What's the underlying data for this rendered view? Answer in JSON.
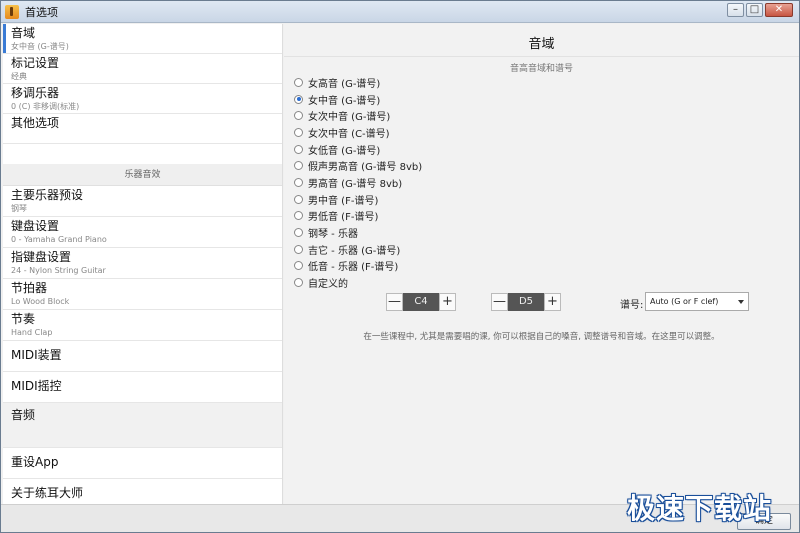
{
  "window": {
    "title": "首选项"
  },
  "sidebar": {
    "items": [
      {
        "label": "音域",
        "sub": "女中音 (G-谱号)"
      },
      {
        "label": "标记设置",
        "sub": "经典"
      },
      {
        "label": "移调乐器",
        "sub": "0 (C) 非移调(标准)"
      },
      {
        "label": "其他选项",
        "sub": ""
      }
    ],
    "section_title": "乐器音效",
    "instrument_items": [
      {
        "label": "主要乐器预设",
        "sub": "钢琴"
      },
      {
        "label": "键盘设置",
        "sub": "0 - Yamaha Grand Piano"
      },
      {
        "label": "指键盘设置",
        "sub": "24 - Nylon String Guitar"
      },
      {
        "label": "节拍器",
        "sub": "Lo Wood Block"
      },
      {
        "label": "节奏",
        "sub": "Hand Clap"
      },
      {
        "label": "MIDI装置",
        "sub": ""
      },
      {
        "label": "MIDI摇控",
        "sub": ""
      }
    ],
    "audio_label": "音频",
    "reset_label": "重设App",
    "about_label": "关于练耳大师"
  },
  "main": {
    "title": "音域",
    "subtitle": "音高音域和谱号",
    "options": [
      {
        "label": "女高音 (G-谱号)",
        "checked": false
      },
      {
        "label": "女中音 (G-谱号)",
        "checked": true
      },
      {
        "label": "女次中音 (G-谱号)",
        "checked": false
      },
      {
        "label": "女次中音 (C-谱号)",
        "checked": false
      },
      {
        "label": "女低音 (G-谱号)",
        "checked": false
      },
      {
        "label": "假声男高音 (G-谱号 8vb)",
        "checked": false
      },
      {
        "label": "男高音 (G-谱号 8vb)",
        "checked": false
      },
      {
        "label": "男中音 (F-谱号)",
        "checked": false
      },
      {
        "label": "男低音 (F-谱号)",
        "checked": false
      },
      {
        "label": "钢琴 - 乐器",
        "checked": false
      },
      {
        "label": "吉它 - 乐器 (G-谱号)",
        "checked": false
      },
      {
        "label": "低音 - 乐器 (F-谱号)",
        "checked": false
      },
      {
        "label": "自定义的",
        "checked": false
      }
    ],
    "low_note": "C4",
    "high_note": "D5",
    "minus": "—",
    "plus": "+",
    "clef_label": "谱号:",
    "clef_value": "Auto (G or F clef)",
    "hint": "在一些课程中, 尤其是需要唱的课, 你可以根据自己的嗓音, 调整谱号和音域。在这里可以调整。"
  },
  "footer": {
    "ok_label": "确定"
  },
  "watermark": "极速下载站",
  "window_buttons": {
    "minimize": "–",
    "maximize": "□",
    "close": "✕"
  }
}
